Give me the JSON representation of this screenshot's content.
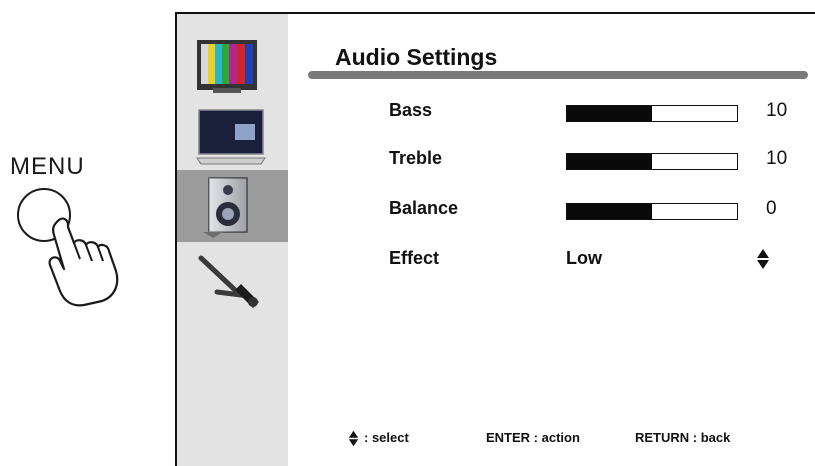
{
  "menu_button": {
    "label": "MENU"
  },
  "sidebar": {
    "items": [
      {
        "icon": "picture-color-bars-icon",
        "active": false
      },
      {
        "icon": "screen-display-icon",
        "active": false
      },
      {
        "icon": "speaker-audio-icon",
        "active": true
      },
      {
        "icon": "tools-setup-icon",
        "active": false
      }
    ]
  },
  "panel": {
    "title": "Audio Settings",
    "rows": [
      {
        "label": "Bass",
        "value": "10",
        "level": 0.5
      },
      {
        "label": "Treble",
        "value": "10",
        "level": 0.5
      },
      {
        "label": "Balance",
        "value": "0",
        "level": 0.5
      }
    ],
    "effect": {
      "label": "Effect",
      "value": "Low"
    }
  },
  "footer": {
    "select": ": select",
    "enter": "ENTER : action",
    "return": "RETURN : back"
  },
  "colors": {
    "sidebar_bg": "#e3e3e3",
    "sidebar_active": "#9b9b9b",
    "rule": "#7a7a7a"
  }
}
